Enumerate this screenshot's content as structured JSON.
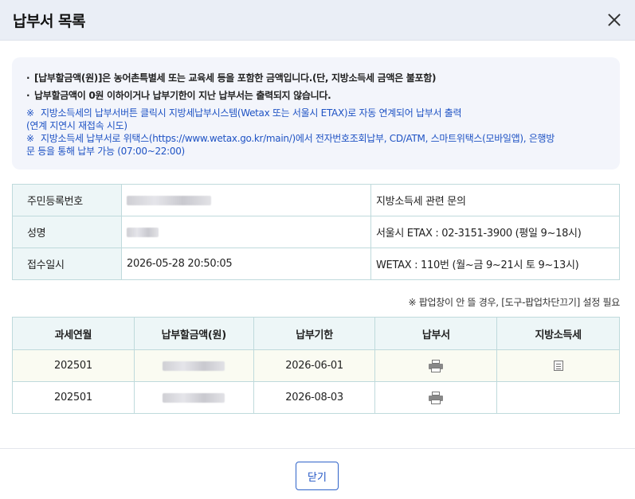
{
  "header": {
    "title": "납부서 목록"
  },
  "notice": {
    "line1": "[납부할금액(원)]은 농어촌특별세 또는 교육세 등을 포함한 금액입니다.(단, 지방소득세 금액은 불포함)",
    "line2": "납부할금액이 0원 이하이거나 납부기한이 지난 납부서는 출력되지 않습니다.",
    "mark": "※",
    "blue1": "지방소득세의 납부서버튼 클릭시 지방세납부시스템(Wetax 또는 서울시 ETAX)로 자동 연계되어 납부서 출력",
    "blue1b": "(연계 지연시 재접속 시도)",
    "blue2": "지방소득세 납부서로 위택스(https://www.wetax.go.kr/main/)에서 전자번호조회납부, CD/ATM, 스마트위택스(모바일앱), 은행방",
    "blue2b": "문 등을 통해 납부 가능 (07:00~22:00)"
  },
  "info": {
    "rows": [
      {
        "label": "주민등록번호",
        "value": "",
        "contact": "지방소득세 관련 문의"
      },
      {
        "label": "성명",
        "value": "",
        "contact": "서울시 ETAX : 02-3151-3900 (평일 9~18시)"
      },
      {
        "label": "접수일시",
        "value": "2026-05-28 20:50:05",
        "contact": "WETAX : 110번 (월~금 9~21시 토 9~13시)"
      }
    ]
  },
  "popup_note": "※ 팝업창이 안 뜰 경우, [도구-팝업차단끄기] 설정 필요",
  "table": {
    "headers": [
      "과세연월",
      "납부할금액(원)",
      "납부기한",
      "납부서",
      "지방소득세"
    ],
    "rows": [
      {
        "period": "202501",
        "amount": "",
        "due": "2026-06-01"
      },
      {
        "period": "202501",
        "amount": "",
        "due": "2026-08-03"
      }
    ]
  },
  "icons": {
    "print": "printer-icon",
    "local_tax": "document-icon",
    "close": "close-icon"
  },
  "footer": {
    "close_label": "닫기"
  },
  "colors": {
    "accent": "#1f53c4",
    "header_bg": "#eaeef6",
    "table_border": "#bfdadc",
    "label_bg": "#edf6f7"
  }
}
